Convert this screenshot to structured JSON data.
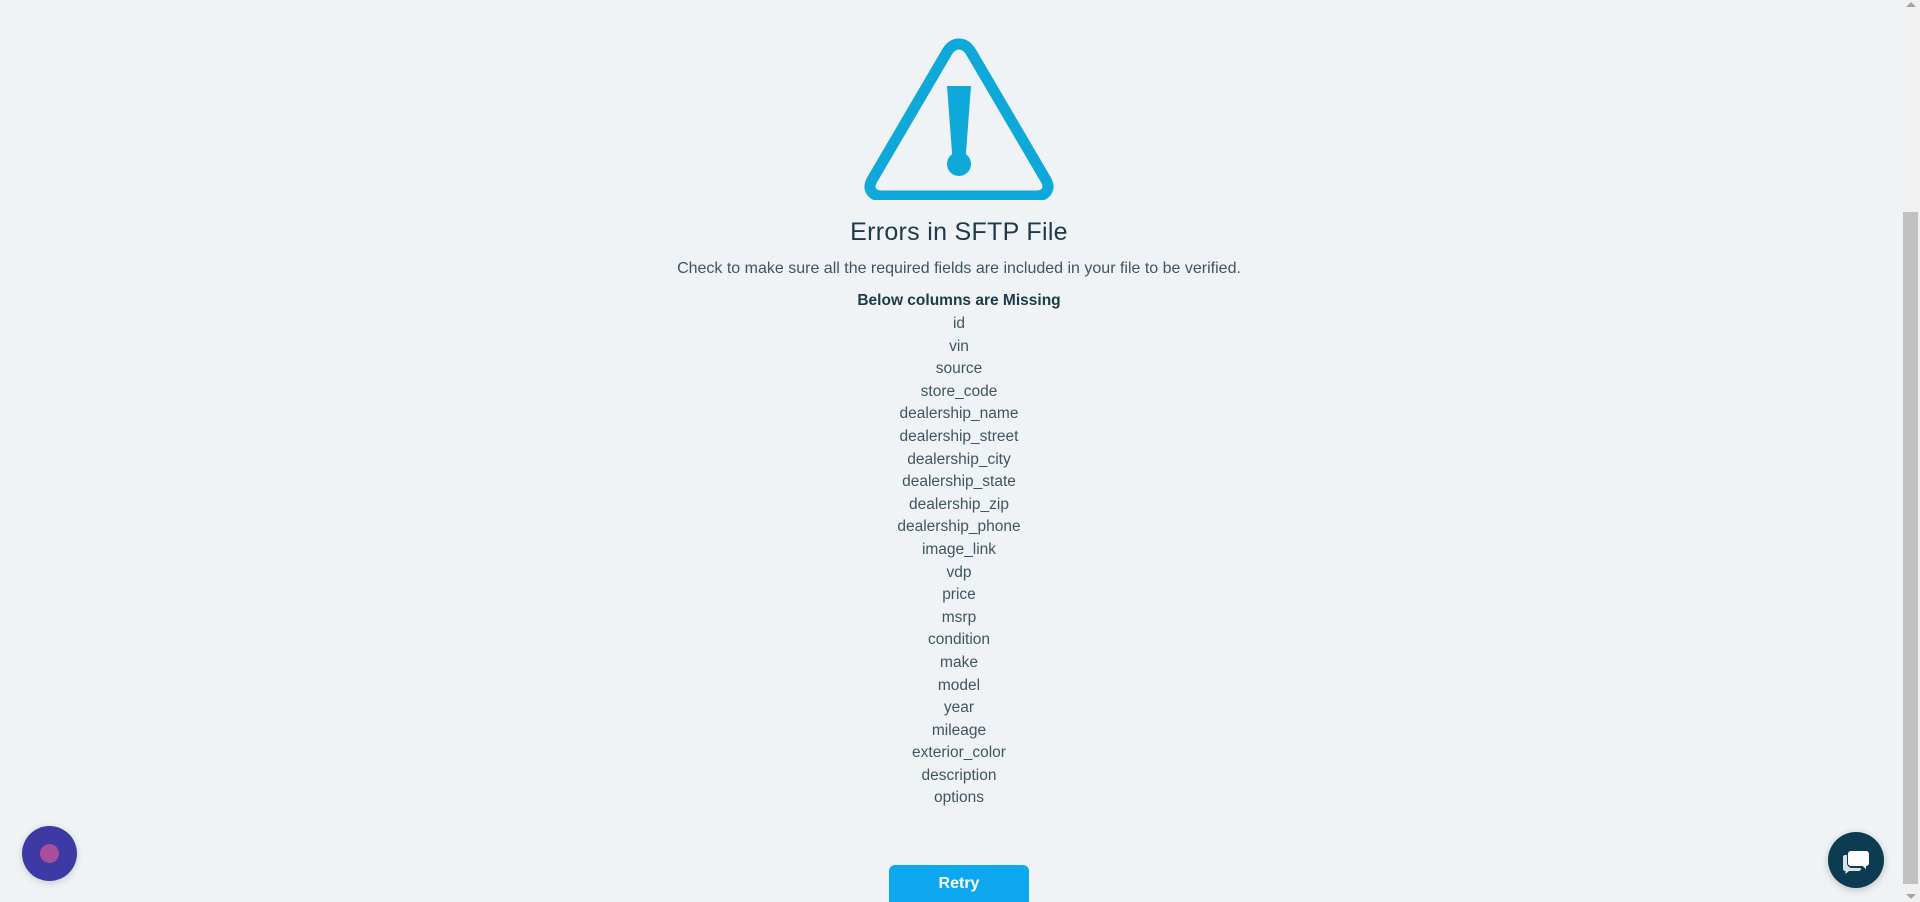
{
  "error": {
    "title": "Errors in SFTP File",
    "message": "Check to make sure all the required fields are included in your file to be verified.",
    "missing_heading": "Below columns are Missing",
    "missing_columns": [
      "id",
      "vin",
      "source",
      "store_code",
      "dealership_name",
      "dealership_street",
      "dealership_city",
      "dealership_state",
      "dealership_zip",
      "dealership_phone",
      "image_link",
      "vdp",
      "price",
      "msrp",
      "condition",
      "make",
      "model",
      "year",
      "mileage",
      "exterior_color",
      "description",
      "options"
    ]
  },
  "actions": {
    "retry_label": "Retry"
  },
  "icons": {
    "warning": "warning-triangle-icon",
    "assistant": "assistant-bubble-icon",
    "chat": "chat-icon"
  },
  "colors": {
    "accent": "#0ca7ee",
    "icon": "#0ea9d9",
    "heading": "#1c3a47",
    "background": "#eff3f5",
    "chat": "#0d3c52",
    "assistant": "#3d3aa6"
  }
}
